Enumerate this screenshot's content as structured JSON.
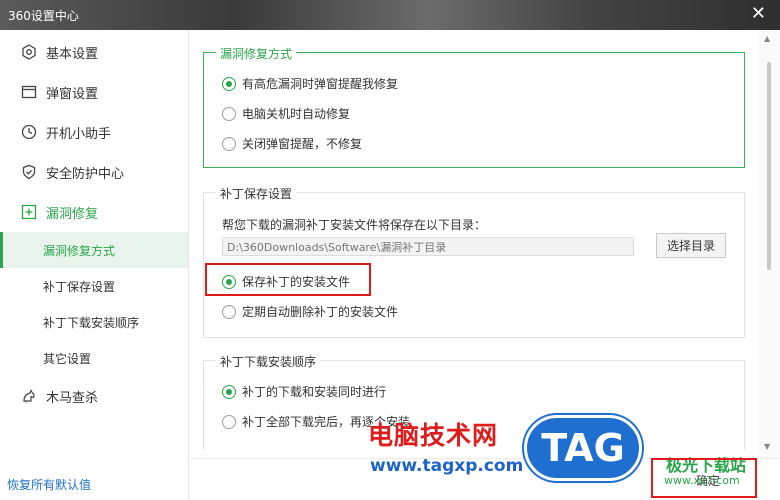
{
  "window": {
    "title": "360设置中心",
    "close_glyph": "✕"
  },
  "sidebar": {
    "items": [
      {
        "label": "基本设置",
        "icon": "settings-hex-icon"
      },
      {
        "label": "弹窗设置",
        "icon": "window-icon"
      },
      {
        "label": "开机小助手",
        "icon": "clock-icon"
      },
      {
        "label": "安全防护中心",
        "icon": "shield-icon"
      },
      {
        "label": "漏洞修复",
        "icon": "plus-box-icon"
      },
      {
        "label": "木马查杀",
        "icon": "horse-icon"
      }
    ],
    "subitems": [
      {
        "label": "漏洞修复方式",
        "active": true
      },
      {
        "label": "补丁保存设置",
        "active": false
      },
      {
        "label": "补丁下载安装顺序",
        "active": false
      },
      {
        "label": "其它设置",
        "active": false
      }
    ],
    "restore_label": "恢复所有默认值"
  },
  "repair_method": {
    "title": "漏洞修复方式",
    "options": [
      {
        "label": "有高危漏洞时弹窗提醒我修复",
        "selected": true
      },
      {
        "label": "电脑关机时自动修复",
        "selected": false
      },
      {
        "label": "关闭弹窗提醒，不修复",
        "selected": false
      }
    ]
  },
  "patch_save": {
    "title": "补丁保存设置",
    "description": "帮您下载的漏洞补丁安装文件将保存在以下目录：",
    "path_value": "D:\\360Downloads\\Software\\漏洞补丁目录",
    "choose_button": "选择目录",
    "options": [
      {
        "label": "保存补丁的安装文件",
        "selected": true
      },
      {
        "label": "定期自动删除补丁的安装文件",
        "selected": false
      }
    ]
  },
  "install_order": {
    "title": "补丁下载安装顺序",
    "options": [
      {
        "label": "补丁的下载和安装同时进行",
        "selected": true
      },
      {
        "label": "补丁全部下载完后，再逐个安装",
        "selected": false
      }
    ]
  },
  "footer": {
    "ok_label": "确定"
  },
  "watermark": {
    "site_cn": "电脑技术网",
    "url": "www.tagxp.com",
    "tag": "TAG",
    "jg": "极光下载站",
    "jg_url": "www.xz7.com"
  },
  "colors": {
    "accent": "#2aa44a",
    "highlight": "#e01b1b",
    "link": "#1e6fd0"
  }
}
